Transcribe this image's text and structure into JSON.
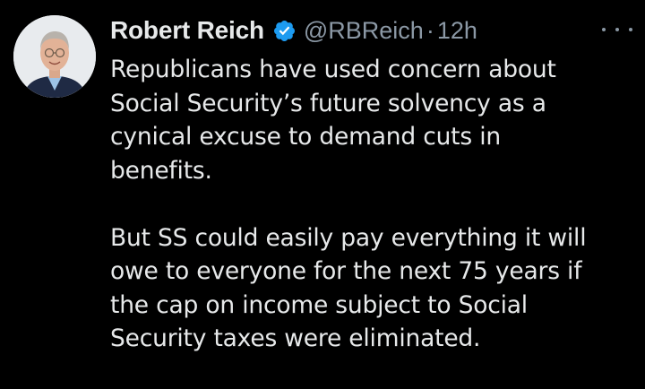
{
  "tweet": {
    "author": {
      "display_name": "Robert Reich",
      "verified_icon": "verified-badge-icon",
      "handle": "@RBReich",
      "separator": "·",
      "time": "12h"
    },
    "more_icon": "more-options-icon",
    "paragraphs": [
      {
        "lines": [
          "Republicans have used concern about",
          "Social Security’s future solvency as a",
          "cynical excuse to demand cuts in",
          "benefits."
        ]
      },
      {
        "lines": [
          "But SS could easily pay everything it will",
          "owe to everyone for the next 75 years if",
          "the cap on income subject to Social",
          "Security taxes were eliminated."
        ]
      }
    ]
  },
  "colors": {
    "background": "#000000",
    "primary_text": "#e7e9ea",
    "secondary_text": "#8b98a5",
    "verified_blue": "#1d9bf0"
  }
}
